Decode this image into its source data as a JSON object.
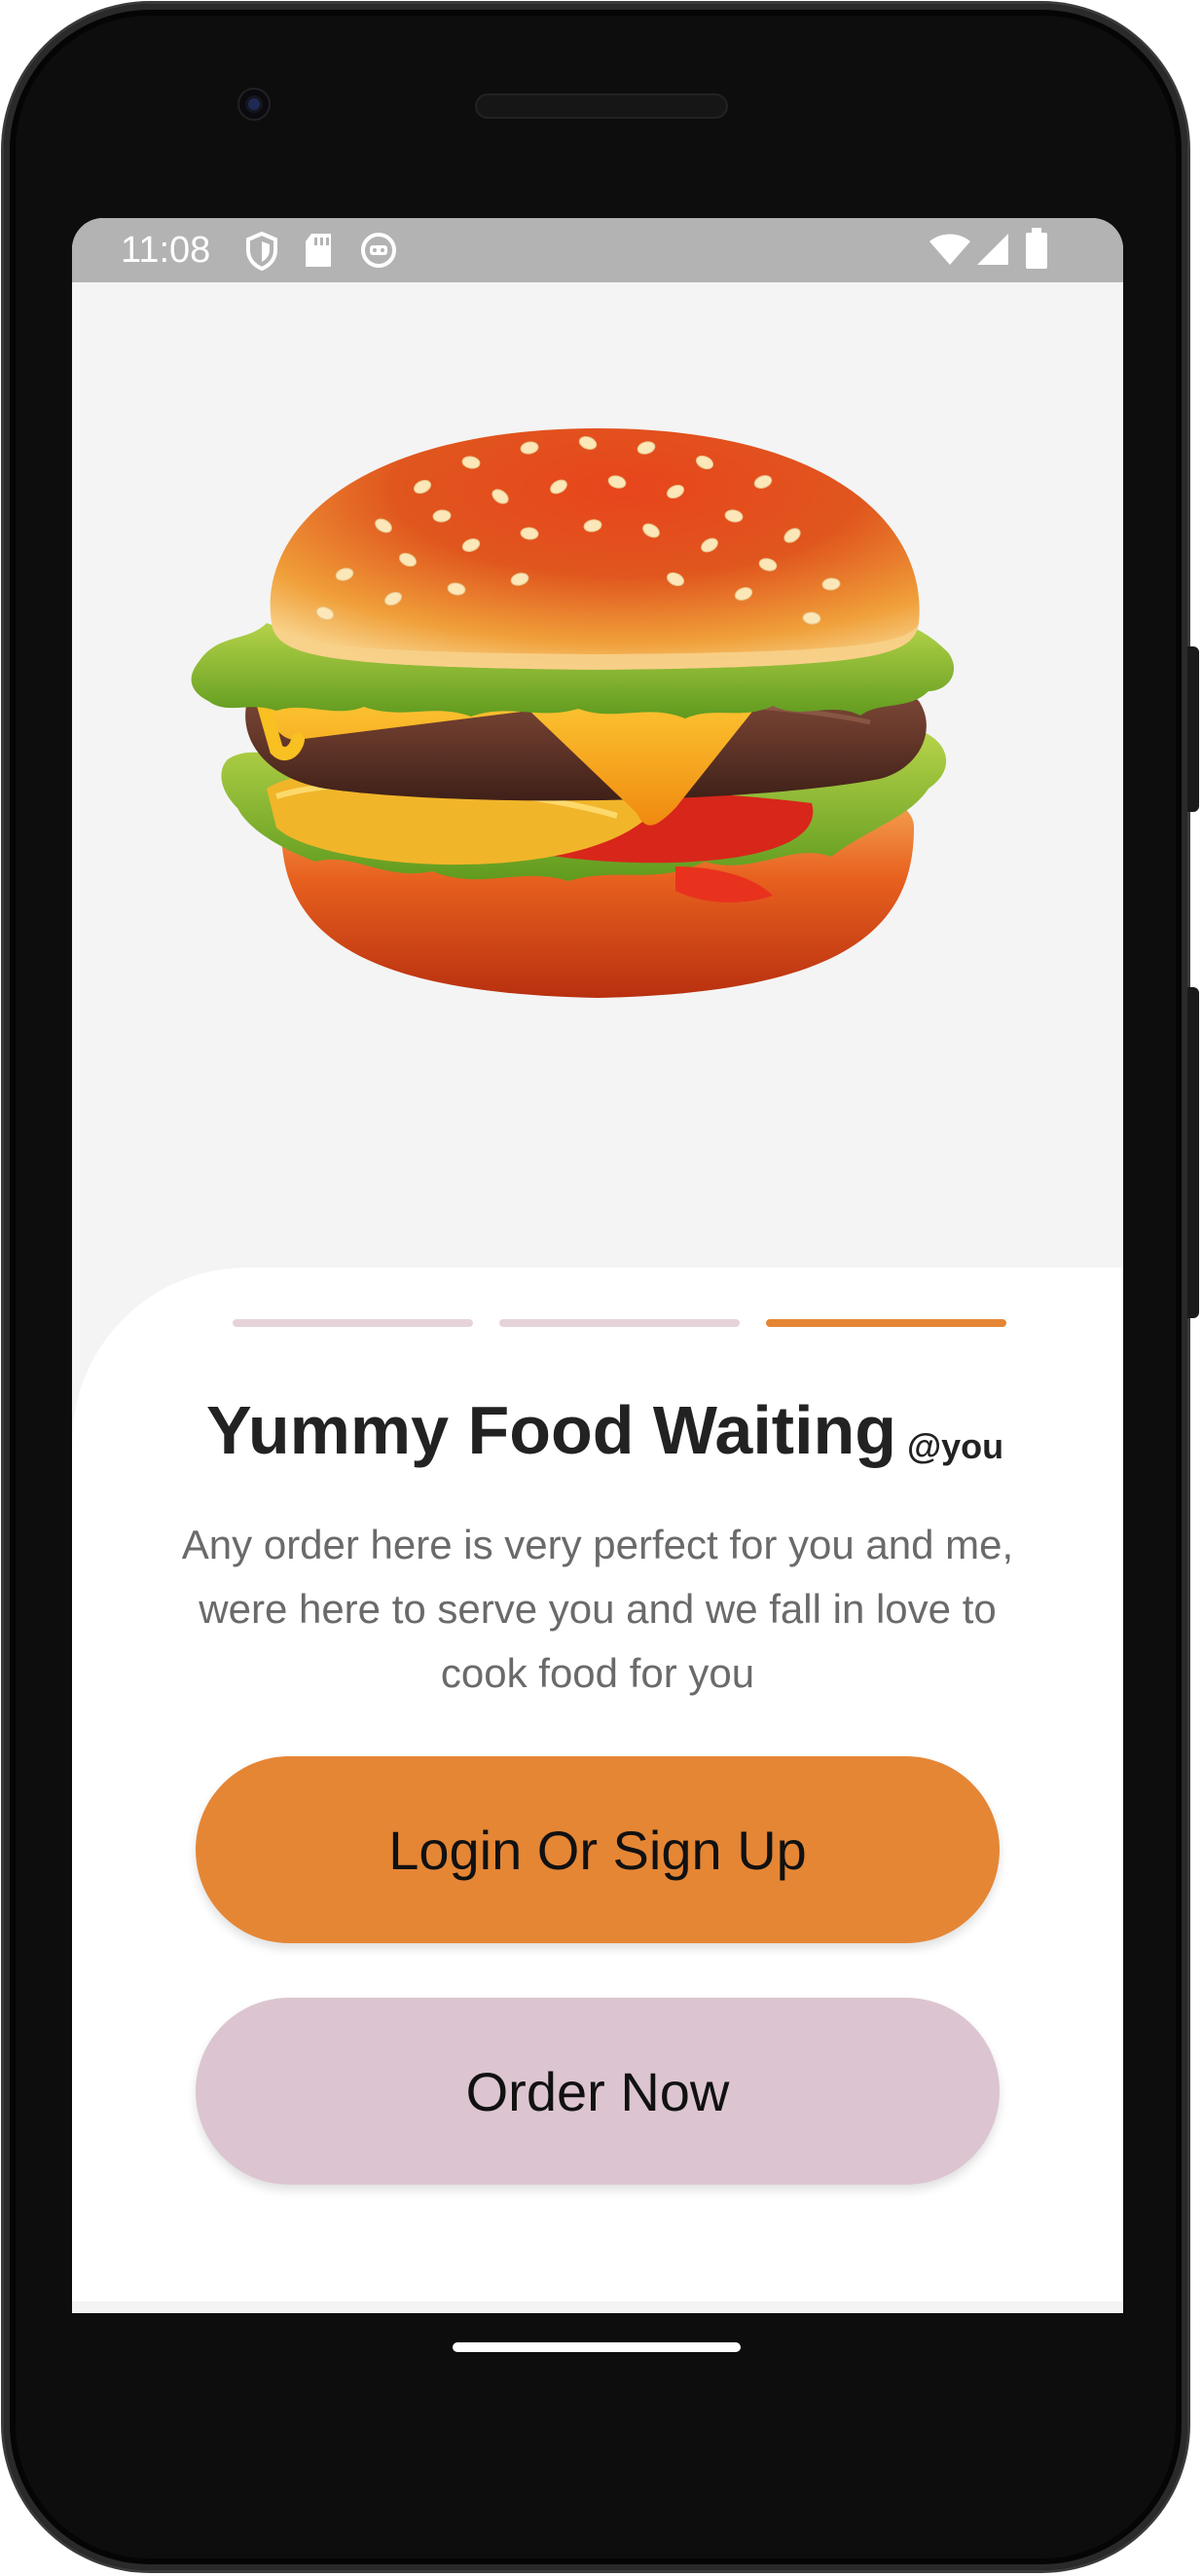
{
  "status_bar": {
    "time": "11:08",
    "icons": [
      "shield-icon",
      "sd-card-icon",
      "face-icon",
      "wifi-icon",
      "signal-icon",
      "battery-icon"
    ]
  },
  "hero": {
    "image": "burger-illustration"
  },
  "pager": {
    "count": 3,
    "active_index": 2,
    "active_color": "#e58635",
    "inactive_color": "#e6d3da"
  },
  "onboarding": {
    "title": "Yummy Food Waiting",
    "title_suffix": "@you",
    "description": "Any order here is very perfect for you and me, were here to serve you and we fall in love to cook food for you"
  },
  "actions": {
    "primary_label": "Login Or Sign Up",
    "secondary_label": "Order Now"
  },
  "colors": {
    "accent": "#e58635",
    "secondary": "#dcc5d0",
    "status_bar": "#b3b3b3"
  }
}
